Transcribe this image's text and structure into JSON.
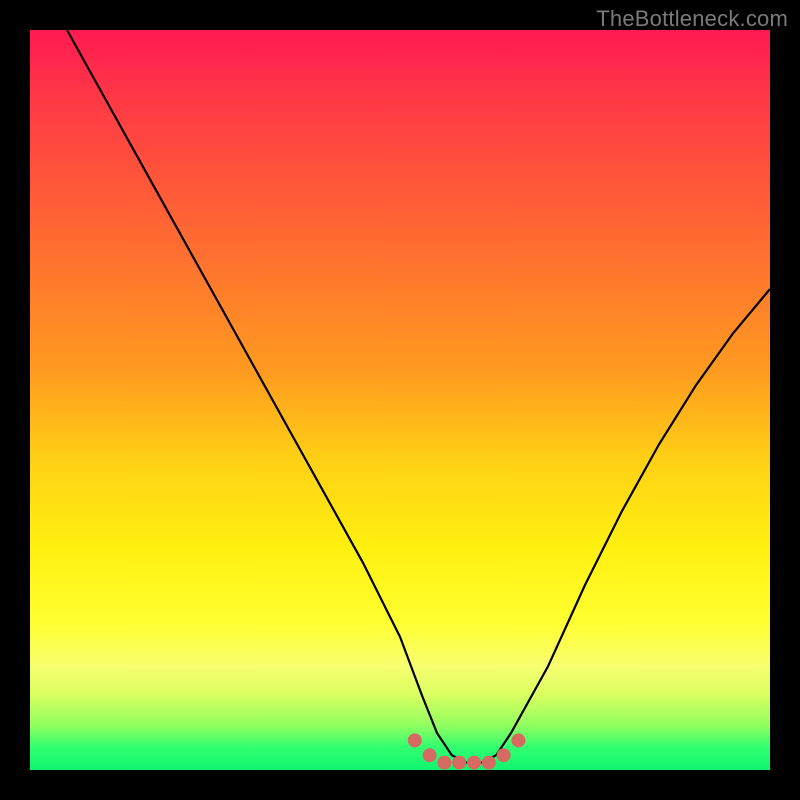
{
  "watermark": "TheBottleneck.com",
  "chart_data": {
    "type": "line",
    "title": "",
    "xlabel": "",
    "ylabel": "",
    "xlim": [
      0,
      100
    ],
    "ylim": [
      0,
      100
    ],
    "series": [
      {
        "name": "bottleneck-curve",
        "x": [
          5,
          10,
          15,
          20,
          25,
          30,
          35,
          40,
          45,
          50,
          53,
          55,
          57,
          59,
          61,
          63,
          65,
          70,
          75,
          80,
          85,
          90,
          95,
          100
        ],
        "values": [
          100,
          91,
          82,
          73,
          64,
          55,
          46,
          37,
          28,
          18,
          10,
          5,
          2,
          1,
          1,
          2,
          5,
          14,
          25,
          35,
          44,
          52,
          59,
          65
        ]
      }
    ],
    "highlight_region": {
      "name": "optimal-marker-dots",
      "color": "#d66a60",
      "x": [
        52,
        54,
        56,
        58,
        60,
        62,
        64,
        66
      ],
      "values": [
        4,
        2,
        1,
        1,
        1,
        1,
        2,
        4
      ]
    },
    "background_gradient_meaning": "red = high bottleneck, green = low bottleneck"
  },
  "colors": {
    "curve": "#000000",
    "dots": "#d66a60",
    "page_bg": "#000000"
  }
}
